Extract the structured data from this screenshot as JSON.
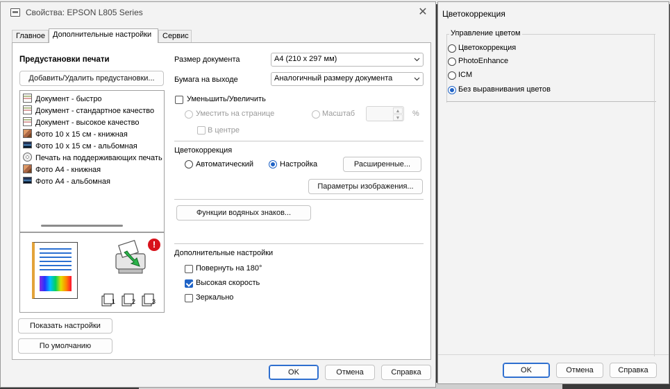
{
  "main_dialog": {
    "title": "Свойства: EPSON L805 Series",
    "close_glyph": "✕",
    "tabs": [
      {
        "label": "Главное"
      },
      {
        "label": "Дополнительные настройки"
      },
      {
        "label": "Сервис"
      }
    ],
    "presets": {
      "title": "Предустановки печати",
      "add_remove_button": "Добавить/Удалить предустановки...",
      "items": [
        {
          "label": "Документ - быстро",
          "icon": "document-icon"
        },
        {
          "label": "Документ - стандартное качество",
          "icon": "document-icon"
        },
        {
          "label": "Документ - высокое качество",
          "icon": "document-icon"
        },
        {
          "label": "Фото 10 x 15 см - книжная",
          "icon": "photo-portrait-icon"
        },
        {
          "label": "Фото 10 x 15 см - альбомная",
          "icon": "photo-landscape-icon"
        },
        {
          "label": "Печать на поддерживающих печать",
          "icon": "disc-icon"
        },
        {
          "label": "Фото A4 - книжная",
          "icon": "photo-portrait-icon"
        },
        {
          "label": "Фото A4 - альбомная",
          "icon": "photo-landscape-icon"
        }
      ],
      "copy_icons": [
        "1",
        "2",
        "3"
      ]
    },
    "document_size": {
      "label": "Размер документа",
      "value": "A4 (210 x 297 мм)"
    },
    "output_paper": {
      "label": "Бумага на выходе",
      "value": "Аналогичный размеру документа"
    },
    "reduce_enlarge": {
      "label": "Уменьшить/Увеличить",
      "checked": false,
      "fit_page": "Уместить на странице",
      "scale": "Масштаб",
      "percent": "%",
      "center": "В центре"
    },
    "color_correction": {
      "title": "Цветокоррекция",
      "auto": "Автоматический",
      "custom": "Настройка",
      "selected": "Настройка",
      "advanced_button": "Расширенные...",
      "image_options_button": "Параметры изображения..."
    },
    "watermark_button": "Функции водяных знаков...",
    "additional": {
      "title": "Дополнительные настройки",
      "rotate": {
        "label": "Повернуть на 180°",
        "checked": false
      },
      "high_speed": {
        "label": "Высокая скорость",
        "checked": true
      },
      "mirror": {
        "label": "Зеркально",
        "checked": false
      }
    },
    "show_settings_button": "Показать настройки",
    "defaults_button": "По умолчанию",
    "ok_button": "OK",
    "cancel_button": "Отмена",
    "help_button": "Справка"
  },
  "color_dialog": {
    "title": "Цветокоррекция",
    "group_title": "Управление цветом",
    "options": [
      {
        "label": "Цветокоррекция",
        "checked": false
      },
      {
        "label": "PhotoEnhance",
        "checked": false
      },
      {
        "label": "ICM",
        "checked": false
      },
      {
        "label": "Без выравнивания цветов",
        "checked": true
      }
    ],
    "ok_button": "OK",
    "cancel_button": "Отмена",
    "help_button": "Справка"
  },
  "colors": {
    "accent": "#1f63c6",
    "warning": "#d8121b"
  }
}
